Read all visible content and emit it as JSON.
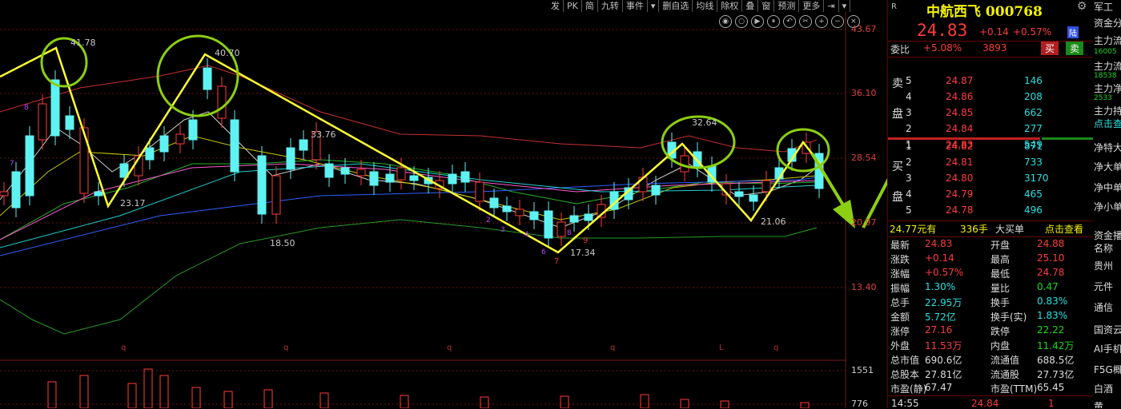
{
  "toolbar": [
    "发",
    "PK",
    "简",
    "九转",
    "事件",
    "▾",
    "删自选",
    "均线",
    "除权",
    "叠",
    "窗",
    "预测",
    "更多",
    "⇥",
    "▾"
  ],
  "icons": [
    "eye-icon",
    "circle-icon",
    "play-icon",
    "pause-icon",
    "undo-icon",
    "scissors-icon",
    "plus-icon",
    "minus-icon",
    "close-icon"
  ],
  "price_axis": [
    "43.67",
    "36.10",
    "28.54",
    "20.97",
    "13.40",
    "1551",
    "776"
  ],
  "chart_labels": {
    "p1": "41.78",
    "p2": "40.70",
    "p3": "23.17",
    "p4": "33.76",
    "p5": "18.50",
    "p6": "17.34",
    "p7": "32.64",
    "p8": "21.06"
  },
  "stock": {
    "r": "R",
    "name": "中航西飞 000768",
    "price": "24.83",
    "change": "+0.14",
    "pct": "+0.57%",
    "tag": "陆"
  },
  "ratio": {
    "label": "委比",
    "value": "+5.08%",
    "vol": "3893",
    "buy": "买",
    "sell": "卖"
  },
  "sell_side": [
    {
      "lvl": "5",
      "price": "24.87",
      "vol": "146"
    },
    {
      "lvl": "4",
      "price": "24.86",
      "vol": "208"
    },
    {
      "lvl": "3",
      "price": "24.85",
      "vol": "662"
    },
    {
      "lvl": "2",
      "price": "24.84",
      "vol": "277"
    },
    {
      "lvl": "1",
      "price": "24.83",
      "vol": "549"
    }
  ],
  "buy_side": [
    {
      "lvl": "1",
      "price": "24.82",
      "vol": "871"
    },
    {
      "lvl": "2",
      "price": "24.81",
      "vol": "733"
    },
    {
      "lvl": "3",
      "price": "24.80",
      "vol": "3170"
    },
    {
      "lvl": "4",
      "price": "24.79",
      "vol": "465"
    },
    {
      "lvl": "5",
      "price": "24.78",
      "vol": "496"
    }
  ],
  "sell_side_label": [
    "卖",
    "盘"
  ],
  "buy_side_label": [
    "买",
    "盘"
  ],
  "order_info": {
    "text": "24.77元有",
    "vol": "336手",
    "big": "大买单",
    "link": "点击查看"
  },
  "stats": [
    {
      "l1": "最新",
      "v1": "24.83",
      "c1": "red",
      "l2": "开盘",
      "v2": "24.88",
      "c2": "red"
    },
    {
      "l1": "涨跌",
      "v1": "+0.14",
      "c1": "red",
      "l2": "最高",
      "v2": "25.10",
      "c2": "red"
    },
    {
      "l1": "涨幅",
      "v1": "+0.57%",
      "c1": "red",
      "l2": "最低",
      "v2": "24.78",
      "c2": "red"
    },
    {
      "l1": "振幅",
      "v1": "1.30%",
      "c1": "cyan",
      "l2": "量比",
      "v2": "0.47",
      "c2": "green"
    },
    {
      "l1": "总手",
      "v1": "22.95万",
      "c1": "cyan",
      "l2": "换手",
      "v2": "0.83%",
      "c2": "cyan"
    },
    {
      "l1": "金额",
      "v1": "5.72亿",
      "c1": "cyan",
      "l2": "换手(实)",
      "v2": "1.83%",
      "c2": "cyan"
    },
    {
      "l1": "涨停",
      "v1": "27.16",
      "c1": "red",
      "l2": "跌停",
      "v2": "22.22",
      "c2": "green"
    },
    {
      "l1": "外盘",
      "v1": "11.53万",
      "c1": "red",
      "l2": "内盘",
      "v2": "11.42万",
      "c2": "green"
    },
    {
      "l1": "总市值",
      "v1": "690.6亿",
      "c1": "white",
      "l2": "流通值",
      "v2": "688.5亿",
      "c2": "white"
    },
    {
      "l1": "总股本",
      "v1": "27.81亿",
      "c1": "white",
      "l2": "流通股",
      "v2": "27.73亿",
      "c2": "white"
    },
    {
      "l1": "市盈(静)",
      "v1": "67.47",
      "c1": "white",
      "l2": "市盈(TTM)",
      "v2": "65.45",
      "c2": "white"
    }
  ],
  "tick": {
    "time": "14:55",
    "price": "24.84",
    "vol": "1"
  },
  "far_right": [
    "军工",
    "资金分",
    "主力流",
    "16005",
    "主力流",
    "18538",
    "主力净",
    "2533",
    "主力持",
    "点击查",
    "净特大",
    "净大单",
    "净中单",
    "净小单",
    "资金播",
    "名称",
    "贵州",
    "元件",
    "通信",
    "国资云",
    "AI手机",
    "F5G概",
    "白酒",
    "黄"
  ]
}
